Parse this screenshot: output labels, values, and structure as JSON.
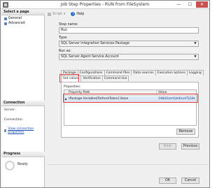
{
  "window": {
    "title": "Job Step Properties - RUN from FileSystem",
    "minimize": "—",
    "maximize": "☐",
    "close": "✕"
  },
  "left_pane": {
    "select_page_header": "Select a page",
    "pages": [
      "General",
      "Advanced"
    ],
    "connection_header": "Connection",
    "server_label": "Server:",
    "server_value": "",
    "connection_label": "Connection:",
    "connection_value": "",
    "view_connection_link": "View connection properties",
    "progress_header": "Progress",
    "progress_status": "Ready"
  },
  "toolbar": {
    "script_label": "Script",
    "help_label": "Help"
  },
  "form": {
    "step_name_label": "Step name:",
    "step_name_value": "Run",
    "type_label": "Type:",
    "type_value": "SQL Server Integration Services Package",
    "run_as_label": "Run as:",
    "run_as_value": "SQL Server Agent Service Account"
  },
  "tabs": {
    "row1": [
      "Package",
      "Configurations",
      "Command files",
      "Data sources",
      "Execution options",
      "Logging"
    ],
    "row2": [
      "Set values",
      "Verification",
      "Command line"
    ],
    "active": "Set values"
  },
  "properties": {
    "label": "Properties:",
    "columns": [
      "Property Path",
      "Value"
    ],
    "rows": [
      {
        "path": "\\Package.Variables[RefreshToken].Value",
        "value": "1/8bGUarVijmEcoVTjG0knvHF7951g..."
      }
    ]
  },
  "buttons": {
    "remove": "Remove",
    "next": "Next",
    "previous": "Previous",
    "ok": "OK",
    "cancel": "Cancel"
  },
  "colors": {
    "highlight": "#e23a3a",
    "selected_row": "#dce8f8",
    "link": "#1a4fb5"
  }
}
